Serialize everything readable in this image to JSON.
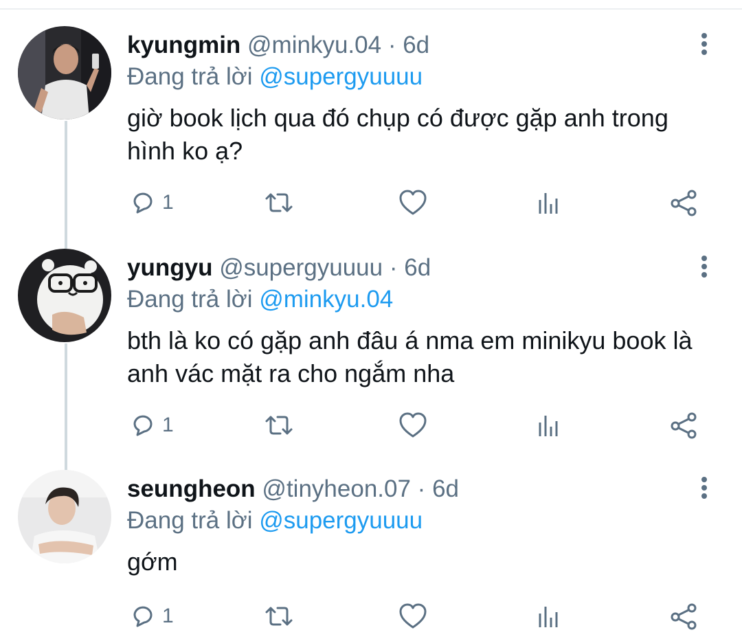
{
  "reply_prefix": "Đang trả lời",
  "colors": {
    "mention": "#1d9bf0",
    "secondary_text": "#5b7083",
    "primary_text": "#0f1419",
    "thread_line": "#cfd9de"
  },
  "icons": {
    "reply": "reply-icon",
    "retweet": "retweet-icon",
    "like": "heart-icon",
    "analytics": "analytics-icon",
    "share": "share-icon",
    "more": "more-vertical-icon"
  },
  "tweets": [
    {
      "name": "kyungmin",
      "handle": "@minkyu.04",
      "separator": "·",
      "time": "6d",
      "reply_to": "@supergyuuuu",
      "text": "giờ book lịch qua đó chụp có được gặp anh trong hình ko ạ?",
      "reply_count": "1"
    },
    {
      "name": "yungyu",
      "handle": "@supergyuuuu",
      "separator": "·",
      "time": "6d",
      "reply_to": "@minkyu.04",
      "text": "bth là ko có gặp anh đâu á nma em minikyu book là anh vác mặt ra cho ngắm nha",
      "reply_count": "1"
    },
    {
      "name": "seungheon",
      "handle": "@tinyheon.07",
      "separator": "·",
      "time": "6d",
      "reply_to": "@supergyuuuu",
      "text": "gớm",
      "reply_count": "1"
    }
  ]
}
